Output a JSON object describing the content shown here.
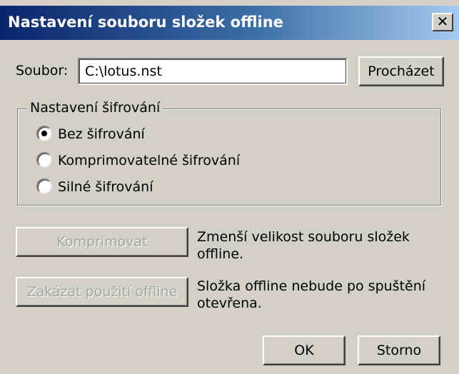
{
  "window": {
    "title": "Nastavení souboru složek offline",
    "close_glyph": "✕"
  },
  "file": {
    "label": "Soubor:",
    "value": "C:\\lotus.nst",
    "browse_label": "Procházet"
  },
  "encryption": {
    "group_label": "Nastavení šifrování",
    "options": [
      {
        "label": "Bez šifrování",
        "selected": true
      },
      {
        "label": "Komprimovatelné šifrování",
        "selected": false
      },
      {
        "label": "Silné šifrování",
        "selected": false
      }
    ]
  },
  "actions": {
    "compress_label": "Komprimovat",
    "compress_desc": "Zmenší velikost souboru složek offline.",
    "disable_label": "Zakázat použití offline",
    "disable_desc": "Složka offline nebude po spuštění otevřena."
  },
  "footer": {
    "ok_label": "OK",
    "cancel_label": "Storno"
  },
  "colors": {
    "titlebar_start": "#0a246a",
    "titlebar_end": "#a6caf0",
    "dialog_face": "#d4d0c8",
    "disabled_text": "#a8a4a0"
  }
}
